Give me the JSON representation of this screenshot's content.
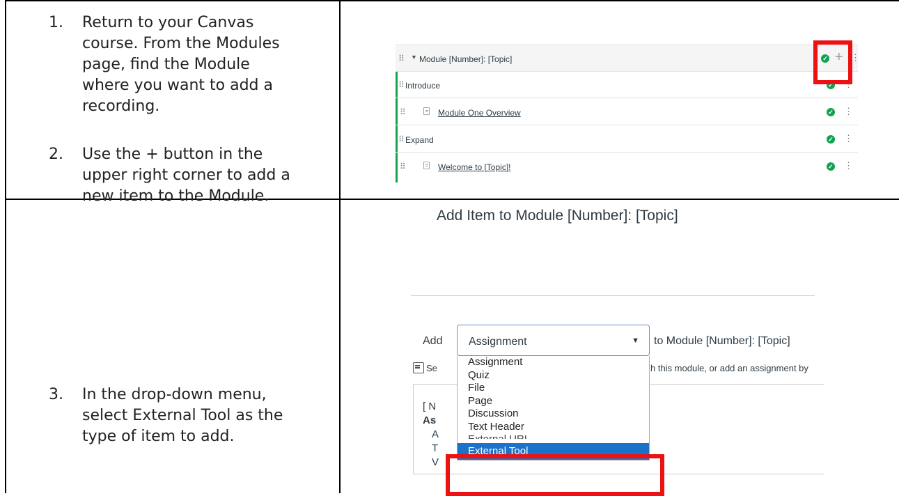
{
  "instructions": {
    "step1": {
      "num": "1.",
      "lines": [
        "Return to your Canvas",
        "course. From the Modules",
        "page, find the Module",
        "where you want to add a",
        "recording."
      ]
    },
    "step2": {
      "num": "2.",
      "lines": [
        "Use the + button in the",
        "upper right corner to add a",
        "new item to the Module."
      ]
    },
    "step3": {
      "num": "3.",
      "lines": [
        "In the drop-down menu,",
        "select External Tool as the",
        "type of item to add."
      ]
    }
  },
  "module_screenshot": {
    "header_title": "Module [Number]: [Topic]",
    "rows": [
      {
        "label": "Introduce",
        "type": "header"
      },
      {
        "label": "Module One Overview",
        "type": "page"
      },
      {
        "label": "Expand",
        "type": "header"
      },
      {
        "label": "Welcome to [Topic]!",
        "type": "page"
      }
    ],
    "highlight_color": "#ee1111",
    "published_color": "#12a150"
  },
  "add_item_dialog": {
    "title": "Add Item to Module [Number]: [Topic]",
    "add_label": "Add",
    "to_module_label": "to Module [Number]: [Topic]",
    "selected_type": "Assignment",
    "note_left": "Se",
    "note_right": "h this module, or add an assignment by",
    "options": [
      "Assignment",
      "Quiz",
      "File",
      "Page",
      "Discussion",
      "Text Header",
      "External URL"
    ],
    "highlighted_option": "External Tool",
    "editor_fragments": [
      "[ N",
      "As",
      "A",
      "T",
      "V"
    ],
    "highlight_color": "#1a73c8"
  }
}
